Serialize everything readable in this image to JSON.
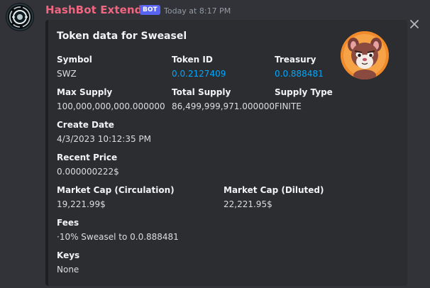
{
  "message": {
    "author": "HashBot Extended",
    "bot_tag": "BOT",
    "timestamp": "Today at 8:17 PM",
    "avatar_icon": "hashbot-logo-icon",
    "author_color": "#f0657f"
  },
  "embed": {
    "title": "Token data for Sweasel",
    "thumbnail_icon": "sweasel-mascot-icon",
    "fields": {
      "symbol": {
        "name": "Symbol",
        "value": "SWZ"
      },
      "token_id": {
        "name": "Token ID",
        "value": "0.0.2127409"
      },
      "treasury": {
        "name": "Treasury",
        "value": "0.0.888481"
      },
      "max_supply": {
        "name": "Max Supply",
        "value": "100,000,000,000.000000"
      },
      "total_supply": {
        "name": "Total Supply",
        "value": "86,499,999,971.000000"
      },
      "supply_type": {
        "name": "Supply Type",
        "value": "FINITE"
      },
      "create_date": {
        "name": "Create Date",
        "value": "4/3/2023 10:12:35 PM"
      },
      "recent_price": {
        "name": "Recent Price",
        "value": "0.000000222$"
      },
      "market_cap_circulation": {
        "name": "Market Cap (Circulation)",
        "value": "19,221.99$"
      },
      "market_cap_diluted": {
        "name": "Market Cap (Diluted)",
        "value": "22,221.95$"
      },
      "fees": {
        "name": "Fees",
        "value": "·10% Sweasel to 0.0.888481"
      },
      "keys": {
        "name": "Keys",
        "value": "None"
      }
    },
    "link_color": "#00a8fc"
  },
  "close_icon": "close-icon"
}
